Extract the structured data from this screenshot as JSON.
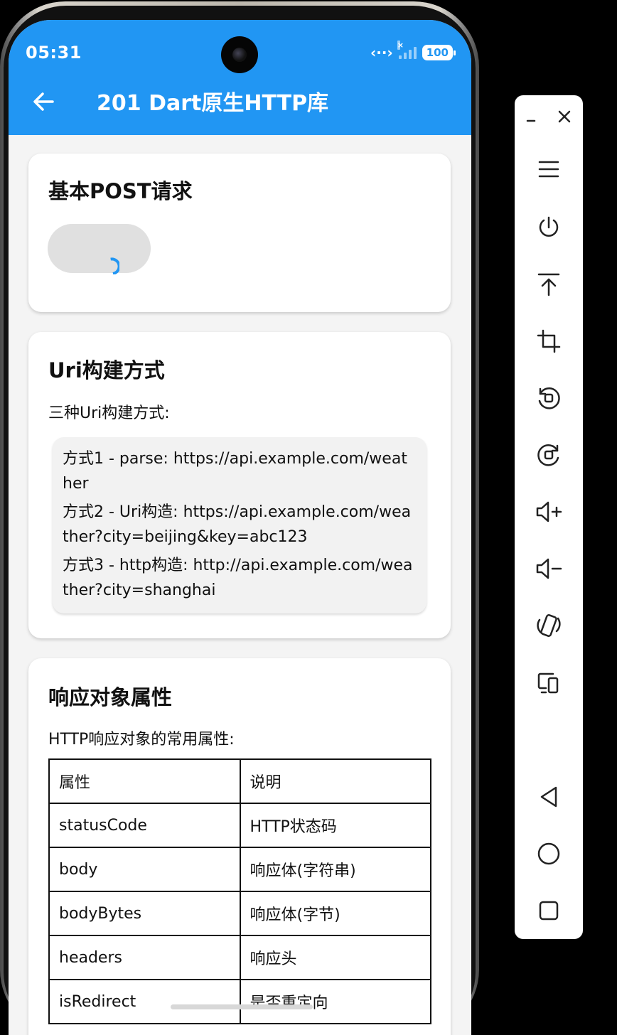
{
  "status_bar": {
    "time": "05:31",
    "battery": "100",
    "icons": [
      "network-icon",
      "signal-icon",
      "battery-icon"
    ]
  },
  "appbar": {
    "title": "201 Dart原生HTTP库",
    "back_icon": "arrow-left-icon"
  },
  "colors": {
    "primary": "#2196f3",
    "background": "#f4f4f4",
    "card": "#ffffff",
    "code_bg": "#f2f2f2"
  },
  "card_post": {
    "title": "基本POST请求",
    "button_state": "loading"
  },
  "card_uri": {
    "title": "Uri构建方式",
    "desc": "三种Uri构建方式:",
    "lines": [
      "方式1 - parse: https://api.example.com/weather",
      "方式2 - Uri构造: https://api.example.com/weather?city=beijing&key=abc123",
      "方式3 - http构造: http://api.example.com/weather?city=shanghai"
    ]
  },
  "card_response": {
    "title": "响应对象属性",
    "desc": "HTTP响应对象的常用属性:",
    "table": {
      "headers": [
        "属性",
        "说明"
      ],
      "rows": [
        [
          "statusCode",
          "HTTP状态码"
        ],
        [
          "body",
          "响应体(字符串)"
        ],
        [
          "bodyBytes",
          "响应体(字节)"
        ],
        [
          "headers",
          "响应头"
        ],
        [
          "isRedirect",
          "是否重定向"
        ]
      ]
    }
  },
  "side_panel": {
    "buttons": [
      "minimize-icon",
      "close-icon",
      "menu-icon",
      "power-icon",
      "pin-top-icon",
      "crop-icon",
      "rotate-left-icon",
      "rotate-right-icon",
      "volume-up-icon",
      "volume-down-icon",
      "shake-icon",
      "multi-device-icon",
      "back-nav-icon",
      "home-nav-icon",
      "recents-nav-icon"
    ]
  }
}
